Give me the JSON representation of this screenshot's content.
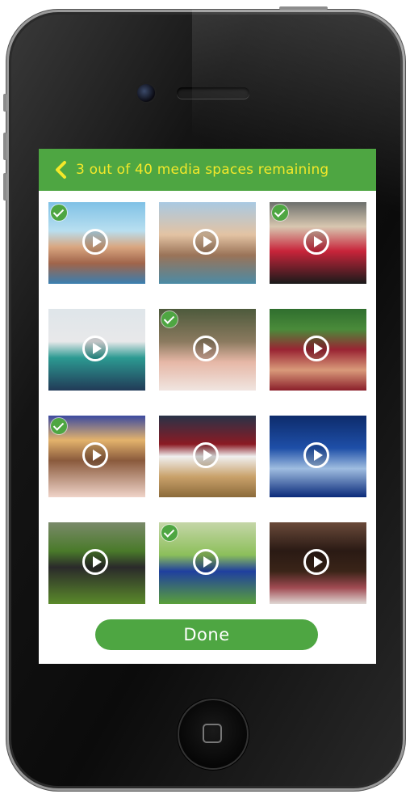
{
  "header": {
    "title": "3 out of 40 media spaces remaining",
    "bar_color": "#4ea642",
    "title_color": "#f3e82a"
  },
  "media": [
    {
      "name": "beach-group-photo",
      "selected": true
    },
    {
      "name": "beach-friends-photo",
      "selected": false
    },
    {
      "name": "toddler-red-tutu-photo",
      "selected": true
    },
    {
      "name": "kids-snow-photo",
      "selected": false
    },
    {
      "name": "soldier-baby-photo",
      "selected": true
    },
    {
      "name": "stadium-cheer-photo",
      "selected": false
    },
    {
      "name": "birthday-girl-photo",
      "selected": true
    },
    {
      "name": "basketball-game-photo",
      "selected": false
    },
    {
      "name": "castle-night-photo",
      "selected": false
    },
    {
      "name": "toddler-soccer-photo",
      "selected": false
    },
    {
      "name": "kids-soccer-match-photo",
      "selected": true
    },
    {
      "name": "kids-selfie-photo",
      "selected": false
    }
  ],
  "done_button": {
    "label": "Done",
    "color": "#4ea642"
  },
  "icons": {
    "back": "chevron-left-icon",
    "play": "play-icon",
    "check": "checkmark-icon"
  }
}
